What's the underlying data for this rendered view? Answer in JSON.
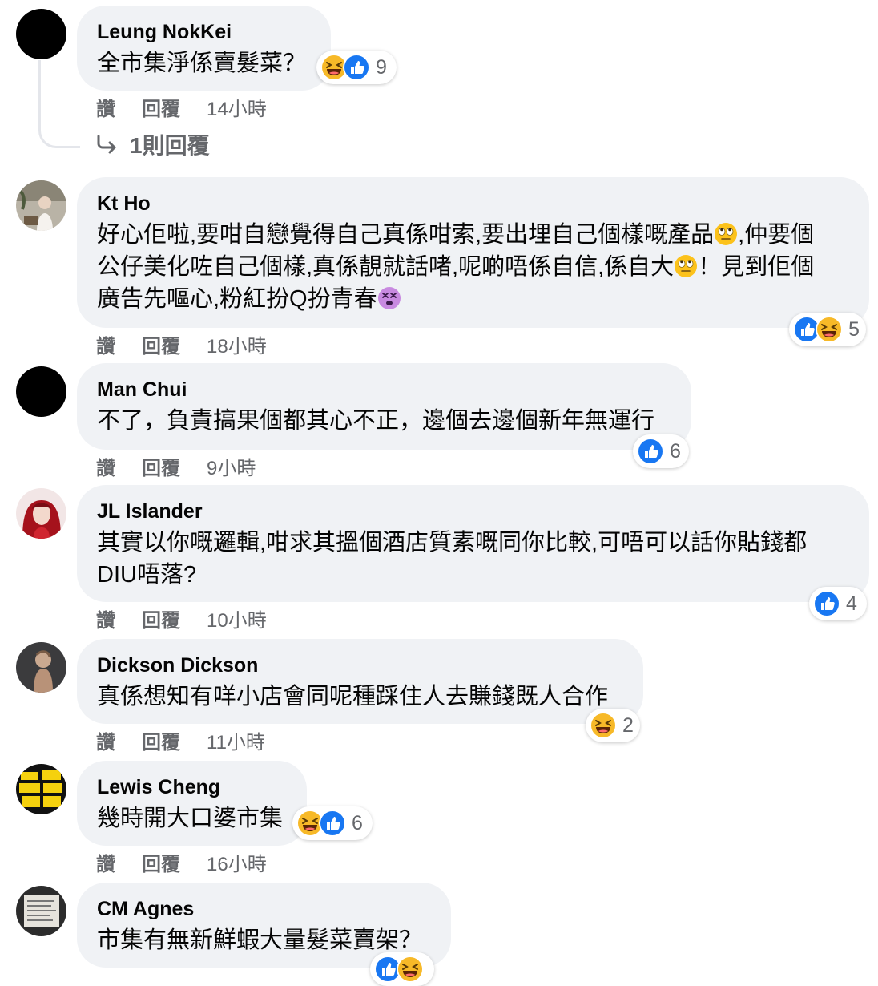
{
  "action_labels": {
    "like": "讚",
    "reply": "回覆"
  },
  "colors": {
    "bubble": "#f0f2f5",
    "meta_text": "#65676b",
    "like_blue": "#1877f2",
    "haha_yellow": "#f7b928"
  },
  "comments": [
    {
      "name": "Leung NokKei",
      "avatar": "black-circle-avatar",
      "text": "全市集淨係賣髮菜？",
      "time": "14小時",
      "reactions": [
        "haha",
        "like"
      ],
      "reaction_count": "9",
      "replies_label": "1則回覆"
    },
    {
      "name": "Kt Ho",
      "avatar": "photo-avatar-person-plant",
      "lines": [
        [
          "好心佢啦,要咁自戀覺得自己真係咁索,要出埋自己個樣嘅產品",
          "eye-roll-emoji",
          ",仲要個"
        ],
        [
          "公仔美化咗自己個樣,真係靚就話啫,呢啲唔係自信,係自大",
          "eye-roll-emoji",
          "！見到佢個"
        ],
        [
          "廣告先嘔心,粉紅扮Q扮青春",
          "dizzy-face-emoji",
          ""
        ]
      ],
      "time": "18小時",
      "reactions": [
        "like",
        "haha"
      ],
      "reaction_count": "5"
    },
    {
      "name": "Man Chui",
      "avatar": "black-circle-avatar",
      "text": "不了，負責搞果個都其心不正，邊個去邊個新年無運行",
      "time": "9小時",
      "reactions": [
        "like"
      ],
      "reaction_count": "6"
    },
    {
      "name": "JL Islander",
      "avatar": "photo-avatar-red-hair",
      "lines": [
        "其實以你嘅邏輯,咁求其搵個酒店質素嘅同你比較,可唔可以話你貼錢都",
        "DIU唔落?"
      ],
      "time": "10小時",
      "reactions": [
        "like"
      ],
      "reaction_count": "4"
    },
    {
      "name": "Dickson Dickson",
      "avatar": "photo-avatar-figure",
      "text": "真係想知有咩小店會同呢種踩住人去賺錢既人合作",
      "time": "11小時",
      "reactions": [
        "haha"
      ],
      "reaction_count": "2"
    },
    {
      "name": "Lewis Cheng",
      "avatar": "yellow-text-avatar",
      "text": "幾時開大口婆市集",
      "time": "16小時",
      "reactions": [
        "haha",
        "like"
      ],
      "reaction_count": "6"
    },
    {
      "name": "CM Agnes",
      "avatar": "photo-avatar-document",
      "text": "市集有無新鮮蝦大量髮菜賣架？",
      "reactions": [
        "like",
        "haha"
      ]
    }
  ]
}
